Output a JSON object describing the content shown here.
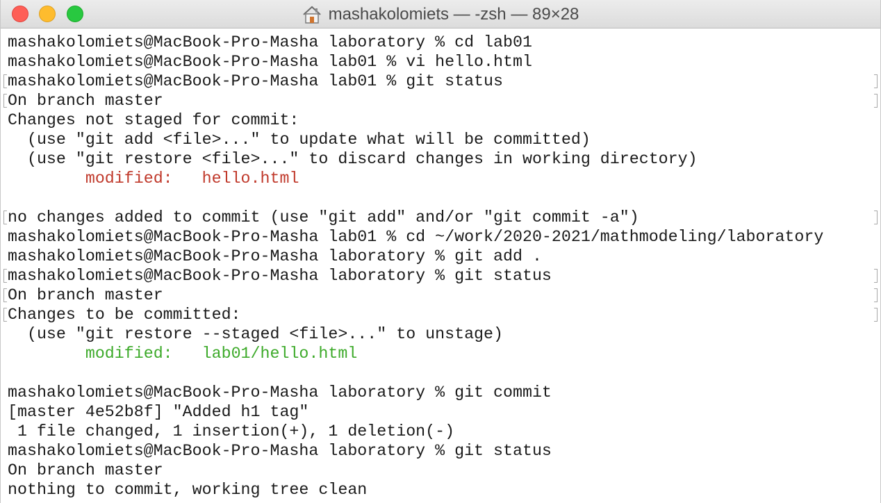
{
  "window": {
    "title": "mashakolomiets — -zsh — 89×28",
    "title_icon": "home-icon"
  },
  "colors": {
    "unstaged": "#c0392b",
    "staged": "#3daa2a",
    "text": "#1a1a1a"
  },
  "terminal": {
    "lines": [
      "mashakolomiets@MacBook-Pro-Masha laboratory % cd lab01",
      "mashakolomiets@MacBook-Pro-Masha lab01 % vi hello.html",
      "mashakolomiets@MacBook-Pro-Masha lab01 % git status",
      "On branch master",
      "Changes not staged for commit:",
      "  (use \"git add <file>...\" to update what will be committed)",
      "  (use \"git restore <file>...\" to discard changes in working directory)",
      "",
      "",
      "no changes added to commit (use \"git add\" and/or \"git commit -a\")",
      "mashakolomiets@MacBook-Pro-Masha lab01 % cd ~/work/2020-2021/mathmodeling/laboratory",
      "mashakolomiets@MacBook-Pro-Masha laboratory % git add .",
      "mashakolomiets@MacBook-Pro-Masha laboratory % git status",
      "On branch master",
      "Changes to be committed:",
      "  (use \"git restore --staged <file>...\" to unstage)",
      "",
      "",
      "mashakolomiets@MacBook-Pro-Masha laboratory % git commit",
      "[master 4e52b8f] \"Added h1 tag\"",
      " 1 file changed, 1 insertion(+), 1 deletion(-)",
      "mashakolomiets@MacBook-Pro-Masha laboratory % git status",
      "On branch master",
      "nothing to commit, working tree clean"
    ],
    "modified_unstaged": {
      "label": "modified:",
      "file": "hello.html"
    },
    "modified_staged": {
      "label": "modified:",
      "file": "lab01/hello.html"
    }
  }
}
